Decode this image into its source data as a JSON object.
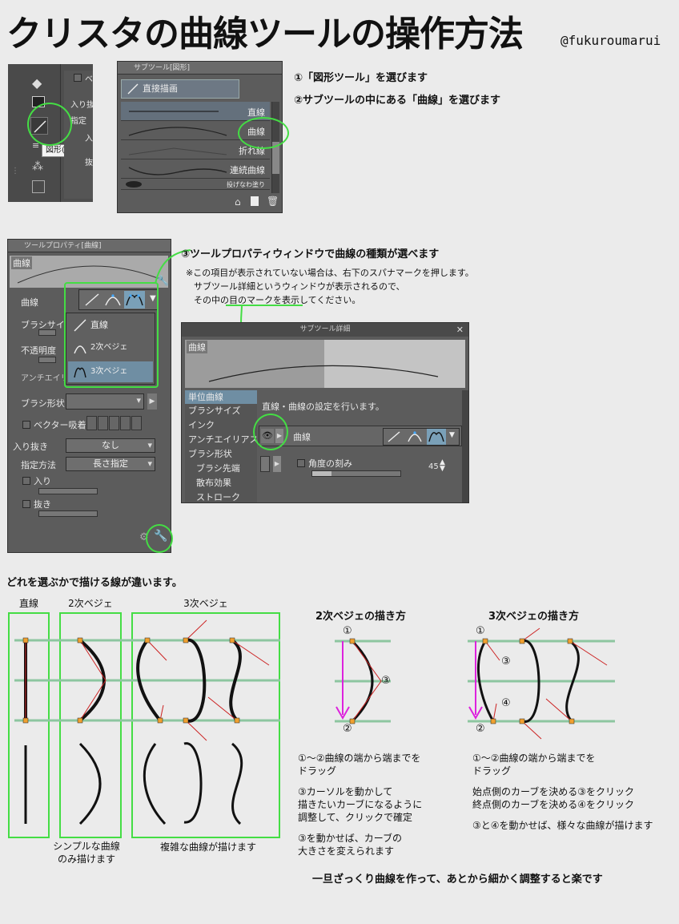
{
  "title": "クリスタの曲線ツールの操作方法",
  "handle": "@fukuroumarui",
  "steps": {
    "step1": "①「図形ツール」を選びます",
    "step2": "②サブツールの中にある「曲線」を選びます",
    "step3": "③ツールプロパティウィンドウで曲線の種類が選べます",
    "note_lines": [
      "※この項目が表示されていない場合は、右下のスパナマークを押します。",
      "サブツール詳細というウィンドウが表示されるので、",
      "その中の目のマークを表示してください。"
    ]
  },
  "toolbar": {
    "tooltip": "図形(U)",
    "side_labels": [
      "ベ",
      "入り抜",
      "指定",
      "入",
      "抜"
    ]
  },
  "subtool": {
    "header": "サブツール[図形]",
    "group": "直接描画",
    "items": [
      "直線",
      "曲線",
      "折れ線",
      "連続曲線",
      "投げなわ塗り"
    ]
  },
  "toolprop": {
    "header": "ツールプロパティ[曲線]",
    "preview_label": "曲線",
    "rows": {
      "curve": "曲線",
      "brush_size": "ブラシサイズ",
      "opacity": "不透明度",
      "antialias": "アンチエイリアス",
      "brush_shape": "ブラシ形状",
      "vector_snap": "ベクター吸着",
      "in_out": "入り抜き",
      "in_out_value": "なし",
      "method": "指定方法",
      "method_value": "長さ指定",
      "in": "入り",
      "out": "抜き"
    },
    "menu": [
      "直線",
      "2次ベジェ",
      "3次ベジェ"
    ]
  },
  "detail": {
    "header": "サブツール詳細",
    "preview_label": "曲線",
    "categories": [
      "単位曲線",
      "ブラシサイズ",
      "インク",
      "アンチエイリアス",
      "ブラシ形状",
      "ブラシ先端",
      "散布効果",
      "ストローク"
    ],
    "description": "直線・曲線の設定を行います。",
    "curve_label": "曲線",
    "angle_label": "角度の刻み",
    "angle_value": "45"
  },
  "bottom": {
    "heading": "どれを選ぶかで描ける線が違います。",
    "col_straight": "直線",
    "col_quad": "2次ベジェ",
    "col_cubic": "3次ベジェ",
    "cap_simple": "シンプルな曲線\nのみ描けます",
    "cap_complex": "複雑な曲線が描けます",
    "quad_title": "2次ベジェの描き方",
    "cubic_title": "3次ベジェの描き方",
    "quad_notes": [
      "①〜②曲線の端から端までを",
      "ドラッグ",
      "③カーソルを動かして",
      "描きたいカーブになるように",
      "調整して、クリックで確定",
      "③を動かせば、カーブの",
      "大きさを変えられます"
    ],
    "cubic_notes": [
      "①〜②曲線の端から端までを",
      "ドラッグ",
      "始点側のカーブを決める③をクリック",
      "終点側のカーブを決める④をクリック",
      "③と④を動かせば、様々な曲線が描けます"
    ],
    "marker1": "①",
    "marker2": "②",
    "marker3": "③",
    "marker4": "④",
    "footer": "一旦ざっくり曲線を作って、あとから細かく調整すると楽です"
  },
  "colors": {
    "highlight": "#44dd44",
    "guide": "#8dc6a0",
    "arrow": "#dd22dd",
    "handle_line": "#cc2222"
  }
}
